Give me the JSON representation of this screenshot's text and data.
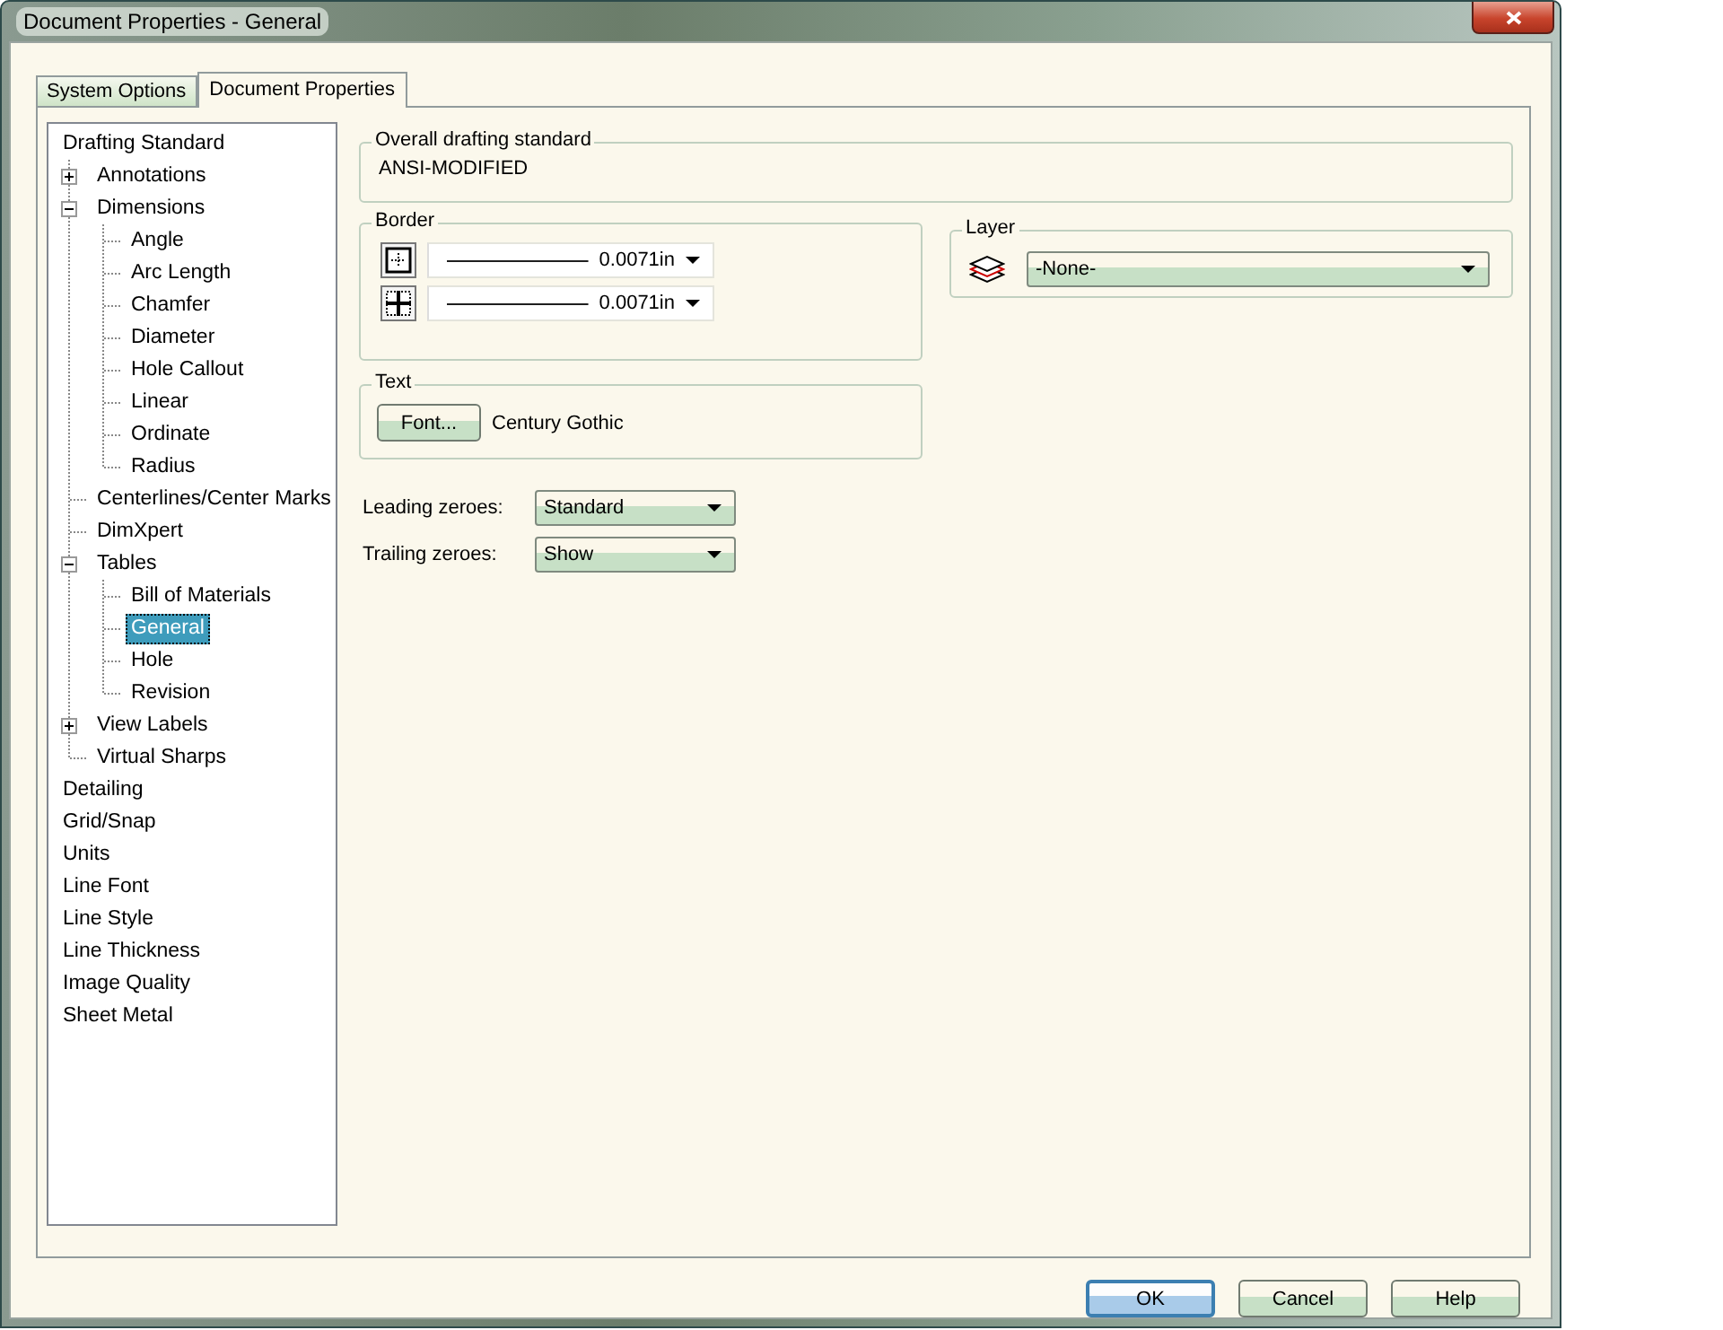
{
  "window": {
    "title": "Document Properties - General"
  },
  "tabs": [
    {
      "label": "System Options",
      "selected": false
    },
    {
      "label": "Document Properties",
      "selected": true
    }
  ],
  "tree": [
    {
      "label": "Drafting Standard",
      "selected": false,
      "children": [
        {
          "label": "Annotations",
          "expanded": false,
          "selected": false
        },
        {
          "label": "Dimensions",
          "expanded": true,
          "selected": false,
          "children": [
            {
              "label": "Angle",
              "selected": false
            },
            {
              "label": "Arc Length",
              "selected": false
            },
            {
              "label": "Chamfer",
              "selected": false
            },
            {
              "label": "Diameter",
              "selected": false
            },
            {
              "label": "Hole Callout",
              "selected": false
            },
            {
              "label": "Linear",
              "selected": false
            },
            {
              "label": "Ordinate",
              "selected": false
            },
            {
              "label": "Radius",
              "selected": false
            }
          ]
        },
        {
          "label": "Centerlines/Center Marks",
          "selected": false
        },
        {
          "label": "DimXpert",
          "selected": false
        },
        {
          "label": "Tables",
          "expanded": true,
          "selected": false,
          "children": [
            {
              "label": "Bill of Materials",
              "selected": false
            },
            {
              "label": "General",
              "selected": true
            },
            {
              "label": "Hole",
              "selected": false
            },
            {
              "label": "Revision",
              "selected": false
            }
          ]
        },
        {
          "label": "View Labels",
          "expanded": false,
          "selected": false
        },
        {
          "label": "Virtual Sharps",
          "selected": false
        }
      ]
    },
    {
      "label": "Detailing",
      "selected": false
    },
    {
      "label": "Grid/Snap",
      "selected": false
    },
    {
      "label": "Units",
      "selected": false
    },
    {
      "label": "Line Font",
      "selected": false
    },
    {
      "label": "Line Style",
      "selected": false
    },
    {
      "label": "Line Thickness",
      "selected": false
    },
    {
      "label": "Image Quality",
      "selected": false
    },
    {
      "label": "Sheet Metal",
      "selected": false
    }
  ],
  "drafting_standard": {
    "label": "Overall drafting standard",
    "value": "ANSI-MODIFIED"
  },
  "border": {
    "label": "Border",
    "rows": [
      {
        "value": "0.0071in"
      },
      {
        "value": "0.0071in"
      }
    ]
  },
  "layer": {
    "label": "Layer",
    "value": "-None-"
  },
  "text": {
    "label": "Text",
    "button": "Font...",
    "font": "Century Gothic"
  },
  "options": [
    {
      "label": "Leading zeroes:",
      "value": "Standard"
    },
    {
      "label": "Trailing zeroes:",
      "value": "Show"
    }
  ],
  "buttons": [
    {
      "label": "OK",
      "default": true
    },
    {
      "label": "Cancel",
      "default": false
    },
    {
      "label": "Help",
      "default": false
    }
  ]
}
